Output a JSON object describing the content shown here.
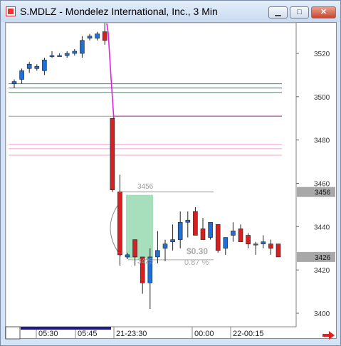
{
  "window": {
    "title": "S.MDLZ - Mondelez International, Inc., 3 Min",
    "minimize_glyph": "▁",
    "maximize_glyph": "□",
    "close_glyph": "✕"
  },
  "colors": {
    "up_candle": "#1f6fd6",
    "down_candle": "#d42020",
    "magenta_line": "#e020e0",
    "green_line": "#20a060",
    "pink_line": "#f0a0d0",
    "highlight_box": "#98d8b0",
    "price_box": "#a8a8a8"
  },
  "chart_data": {
    "type": "candlestick",
    "x_ticks": [
      "05:30",
      "05:45",
      "21-23:30",
      "00:00",
      "22-00:15"
    ],
    "y_ticks": [
      "3520",
      "3500",
      "3480",
      "3460",
      "3440",
      "3420",
      "3400"
    ],
    "price_labels": [
      "3456",
      "3426"
    ],
    "annotations": {
      "high_label": "3456",
      "low_label": "3425",
      "profit": "$0.30",
      "percent": "0.87 %"
    },
    "candles": [
      {
        "o": 3506,
        "h": 3508,
        "l": 3504,
        "c": 3507
      },
      {
        "o": 3508,
        "h": 3513,
        "l": 3506,
        "c": 3512
      },
      {
        "o": 3513,
        "h": 3516,
        "l": 3511,
        "c": 3515
      },
      {
        "o": 3513,
        "h": 3515,
        "l": 3512,
        "c": 3514
      },
      {
        "o": 3512,
        "h": 3518,
        "l": 3510,
        "c": 3517
      },
      {
        "o": 3519,
        "h": 3521,
        "l": 3518,
        "c": 3519
      },
      {
        "o": 3519,
        "h": 3520,
        "l": 3519,
        "c": 3519
      },
      {
        "o": 3519,
        "h": 3521,
        "l": 3518,
        "c": 3520
      },
      {
        "o": 3520,
        "h": 3522,
        "l": 3519,
        "c": 3521
      },
      {
        "o": 3520,
        "h": 3528,
        "l": 3518,
        "c": 3526
      },
      {
        "o": 3527,
        "h": 3529,
        "l": 3526,
        "c": 3528
      },
      {
        "o": 3527,
        "h": 3530,
        "l": 3526,
        "c": 3529
      },
      {
        "o": 3530,
        "h": 3534,
        "l": 3524,
        "c": 3526
      },
      {
        "o": 3490,
        "h": 3490,
        "l": 3456,
        "c": 3457
      },
      {
        "o": 3456,
        "h": 3464,
        "l": 3422,
        "c": 3427
      },
      {
        "o": 3426,
        "h": 3428,
        "l": 3425,
        "c": 3427
      },
      {
        "o": 3434,
        "h": 3434,
        "l": 3422,
        "c": 3426
      },
      {
        "o": 3426,
        "h": 3426,
        "l": 3409,
        "c": 3414
      },
      {
        "o": 3414,
        "h": 3430,
        "l": 3402,
        "c": 3426
      },
      {
        "o": 3426,
        "h": 3438,
        "l": 3423,
        "c": 3429
      },
      {
        "o": 3430,
        "h": 3434,
        "l": 3424,
        "c": 3432
      },
      {
        "o": 3433,
        "h": 3441,
        "l": 3429,
        "c": 3434
      },
      {
        "o": 3434,
        "h": 3447,
        "l": 3430,
        "c": 3442
      },
      {
        "o": 3442,
        "h": 3447,
        "l": 3435,
        "c": 3443
      },
      {
        "o": 3447,
        "h": 3449,
        "l": 3436,
        "c": 3436
      },
      {
        "o": 3439,
        "h": 3444,
        "l": 3434,
        "c": 3434
      },
      {
        "o": 3435,
        "h": 3442,
        "l": 3434,
        "c": 3442
      },
      {
        "o": 3441,
        "h": 3441,
        "l": 3428,
        "c": 3429
      },
      {
        "o": 3430,
        "h": 3435,
        "l": 3427,
        "c": 3435
      },
      {
        "o": 3436,
        "h": 3442,
        "l": 3433,
        "c": 3438
      },
      {
        "o": 3439,
        "h": 3441,
        "l": 3433,
        "c": 3433
      },
      {
        "o": 3436,
        "h": 3437,
        "l": 3430,
        "c": 3432
      },
      {
        "o": 3432,
        "h": 3433,
        "l": 3427,
        "c": 3432
      },
      {
        "o": 3432,
        "h": 3436,
        "l": 3430,
        "c": 3433
      },
      {
        "o": 3432,
        "h": 3434,
        "l": 3427,
        "c": 3430
      },
      {
        "o": 3432,
        "h": 3432,
        "l": 3426,
        "c": 3426
      }
    ],
    "horizontal_lines": [
      {
        "price": 3506,
        "color": "green"
      },
      {
        "price": 3504,
        "color": "blue"
      },
      {
        "price": 3502,
        "color": "green"
      },
      {
        "price": 3491,
        "color": "magenta"
      },
      {
        "price": 3491,
        "color": "gray"
      },
      {
        "price": 3478,
        "color": "pink"
      },
      {
        "price": 3476,
        "color": "pink"
      },
      {
        "price": 3473,
        "color": "pink"
      },
      {
        "price": 3456,
        "color": "gray"
      }
    ]
  }
}
